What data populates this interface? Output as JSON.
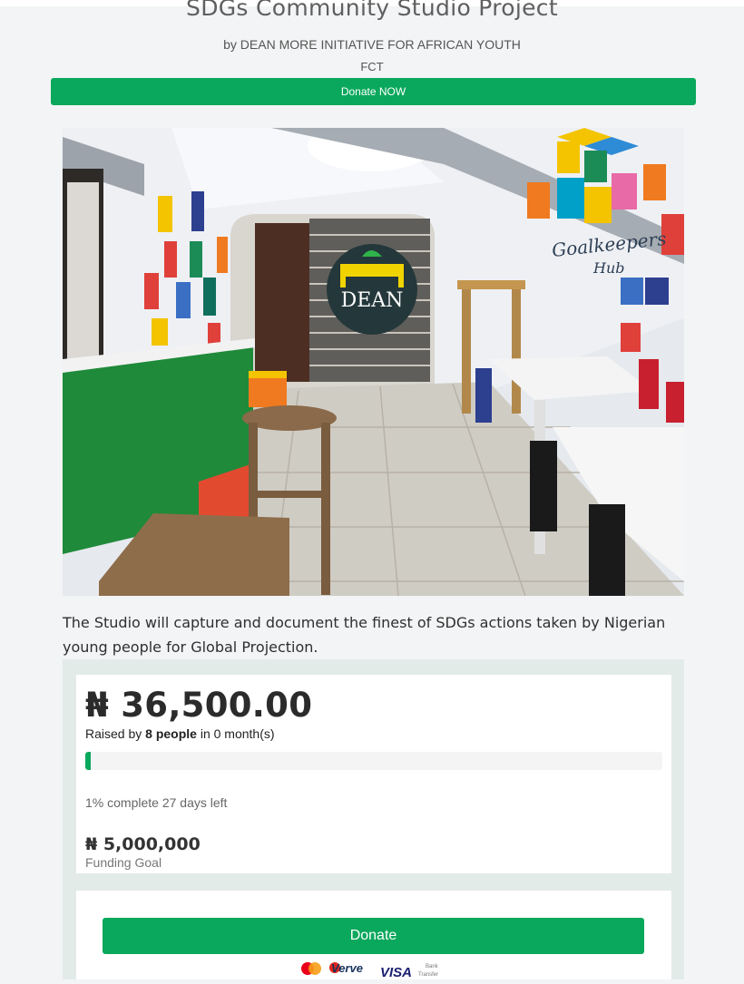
{
  "header": {
    "title": "SDGs Community Studio Project",
    "byline": "by DEAN MORE INITIATIVE FOR AFRICAN YOUTH",
    "location": "FCT",
    "donate_now_label": "Donate NOW"
  },
  "photo": {
    "logo_text": "DEAN",
    "wall_sign": "Goalkeepers",
    "wall_sign_2": "Hub"
  },
  "description": "The Studio will capture and document the finest of SDGs actions taken by Nigerian young people for Global Projection.",
  "funding": {
    "amount_raised": "₦ 36,500.00",
    "raised_prefix": "Raised by ",
    "people": "8 people",
    "raised_suffix": " in 0 month(s)",
    "progress_fraction": 0.01,
    "complete_text": "1% complete 27 days left",
    "goal_amount": "₦ 5,000,000",
    "goal_label": "Funding Goal"
  },
  "donate": {
    "button_label": "Donate",
    "payment_methods": {
      "verve": "Verve",
      "visa": "VISA",
      "bank_1": "Bank",
      "bank_2": "Transfer"
    }
  },
  "colors": {
    "accent": "#0aa85c",
    "panel": "#e3ebe9"
  }
}
